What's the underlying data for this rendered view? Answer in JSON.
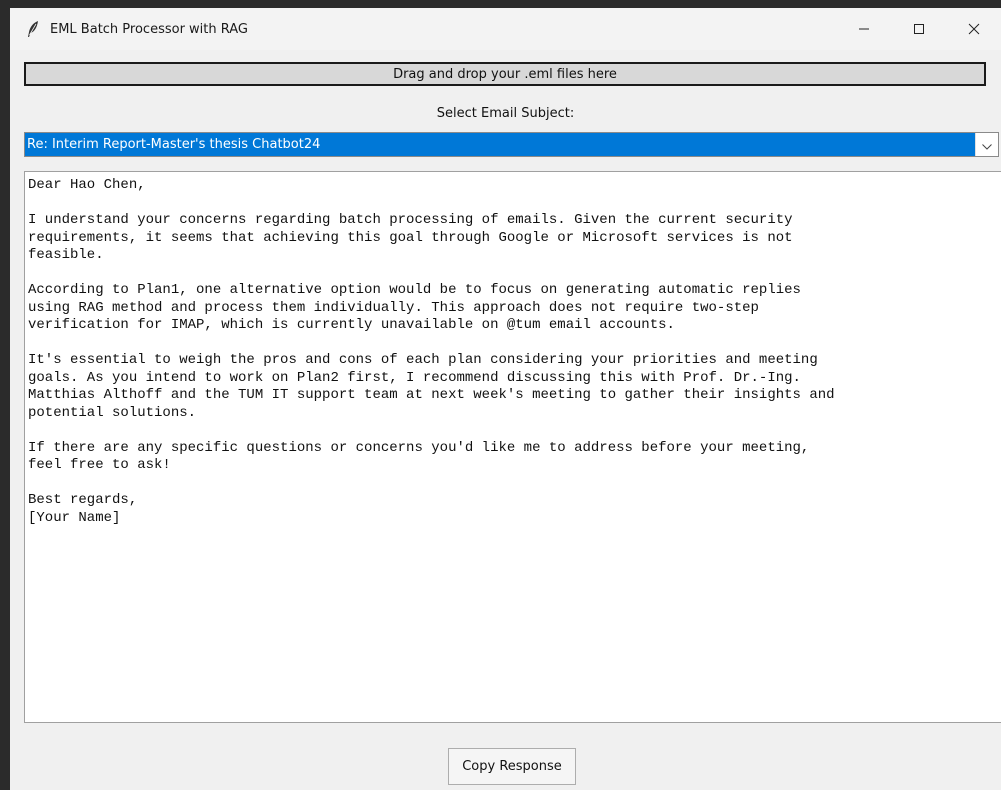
{
  "window": {
    "title": "EML Batch Processor with RAG",
    "icon": "feather-icon",
    "controls": [
      "minimize-icon",
      "maximize-icon",
      "close-icon"
    ]
  },
  "drop_zone": {
    "label": "Drag and drop your .eml files here"
  },
  "subject_select": {
    "label": "Select Email Subject:",
    "selected": "Re: Interim Report-Master's thesis Chatbot24",
    "highlight_color": "#0078d7"
  },
  "response": {
    "lines": [
      "Dear Hao Chen,",
      "",
      "I understand your concerns regarding batch processing of emails. Given the current security",
      "requirements, it seems that achieving this goal through Google or Microsoft services is not",
      "feasible.",
      "",
      "According to Plan1, one alternative option would be to focus on generating automatic replies",
      "using RAG method and process them individually. This approach does not require two-step",
      "verification for IMAP, which is currently unavailable on @tum email accounts.",
      "",
      "It's essential to weigh the pros and cons of each plan considering your priorities and meeting",
      "goals. As you intend to work on Plan2 first, I recommend discussing this with Prof. Dr.-Ing.",
      "Matthias Althoff and the TUM IT support team at next week's meeting to gather their insights and",
      "potential solutions.",
      "",
      "If there are any specific questions or concerns you'd like me to address before your meeting,",
      "feel free to ask!",
      "",
      "Best regards,",
      "[Your Name]"
    ]
  },
  "actions": {
    "copy_label": "Copy Response"
  }
}
